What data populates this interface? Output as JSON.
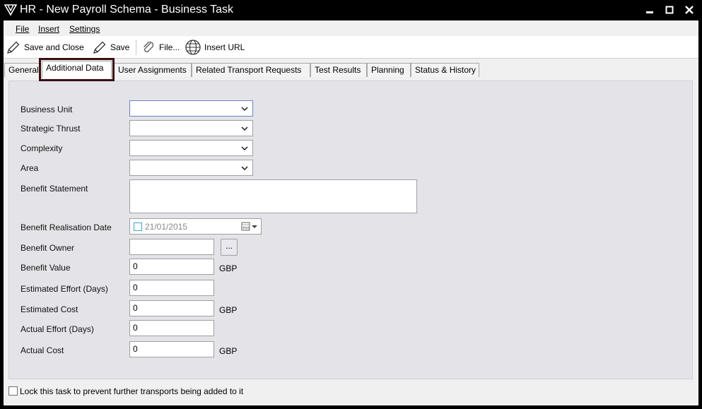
{
  "window": {
    "title": "HR - New Payroll Schema - Business Task"
  },
  "menu": {
    "file": "File",
    "insert": "Insert",
    "settings": "Settings"
  },
  "toolbar": {
    "save_and_close": "Save and Close",
    "save": "Save",
    "file": "File...",
    "insert_url": "Insert URL"
  },
  "tabs": [
    {
      "label": "General",
      "active": false
    },
    {
      "label": "Additional Data",
      "active": true
    },
    {
      "label": "User Assignments",
      "active": false
    },
    {
      "label": "Related Transport Requests",
      "active": false
    },
    {
      "label": "Test Results",
      "active": false
    },
    {
      "label": "Planning",
      "active": false
    },
    {
      "label": "Status & History",
      "active": false
    }
  ],
  "form": {
    "business_unit": {
      "label": "Business Unit",
      "value": ""
    },
    "strategic_thrust": {
      "label": "Strategic Thrust",
      "value": ""
    },
    "complexity": {
      "label": "Complexity",
      "value": ""
    },
    "area": {
      "label": "Area",
      "value": ""
    },
    "benefit_statement": {
      "label": "Benefit Statement",
      "value": ""
    },
    "benefit_realisation_date": {
      "label": "Benefit Realisation Date",
      "value": "21/01/2015"
    },
    "benefit_owner": {
      "label": "Benefit Owner",
      "value": "",
      "browse_label": "..."
    },
    "benefit_value": {
      "label": "Benefit Value",
      "value": "0",
      "unit": "GBP"
    },
    "estimated_effort": {
      "label": "Estimated Effort (Days)",
      "value": "0"
    },
    "estimated_cost": {
      "label": "Estimated Cost",
      "value": "0",
      "unit": "GBP"
    },
    "actual_effort": {
      "label": "Actual Effort (Days)",
      "value": "0"
    },
    "actual_cost": {
      "label": "Actual Cost",
      "value": "0",
      "unit": "GBP"
    }
  },
  "lock_checkbox": {
    "label": "Lock this task to prevent further transports being added to it",
    "checked": false
  }
}
